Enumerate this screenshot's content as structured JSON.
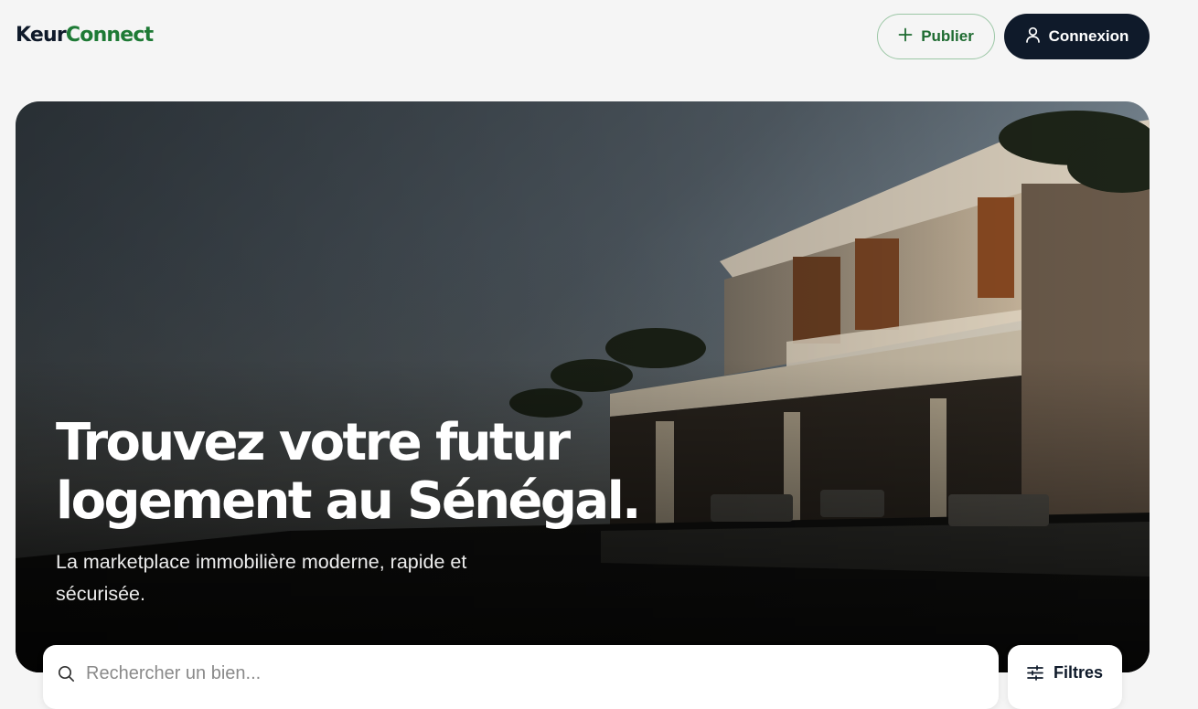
{
  "brand": {
    "name_part1": "Keur",
    "name_part2": "Connect",
    "accent_color": "#1e7a35",
    "dark_color": "#0f1a2a"
  },
  "header": {
    "publish_label": "Publier",
    "login_label": "Connexion"
  },
  "hero": {
    "title_line1": "Trouvez votre futur",
    "title_line2": "logement au Sénégal.",
    "subtitle": "La marketplace immobilière moderne, rapide et sécurisée."
  },
  "search": {
    "placeholder": "Rechercher un bien...",
    "value": ""
  },
  "filters": {
    "label": "Filtres"
  },
  "icons": {
    "publish": "plus-icon",
    "login": "user-icon",
    "search": "search-icon",
    "filters": "sliders-icon"
  }
}
